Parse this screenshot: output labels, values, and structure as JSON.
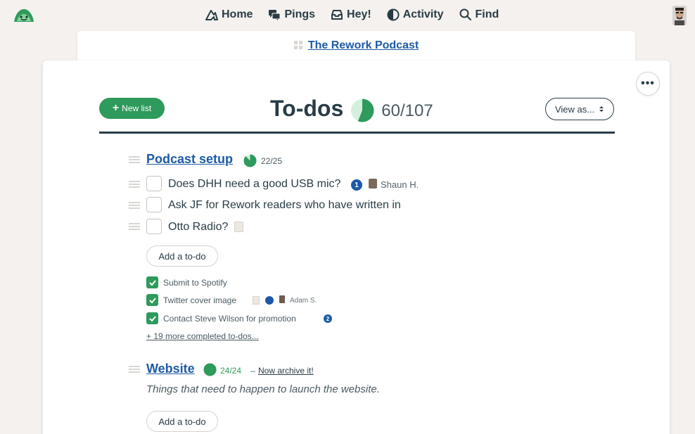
{
  "nav": {
    "items": [
      {
        "label": "Home",
        "icon": "home-icon"
      },
      {
        "label": "Pings",
        "icon": "pings-icon"
      },
      {
        "label": "Hey!",
        "icon": "hey-icon"
      },
      {
        "label": "Activity",
        "icon": "activity-icon"
      },
      {
        "label": "Find",
        "icon": "search-icon"
      }
    ]
  },
  "project": {
    "name": "The Rework Podcast"
  },
  "header": {
    "new_list_label": "New list",
    "title": "To-dos",
    "count": "60/107",
    "progress": 0.56,
    "view_as_label": "View as...",
    "more_label": "•••"
  },
  "lists": [
    {
      "title": "Podcast setup",
      "count": "22/25",
      "progress": 0.88,
      "todos": [
        {
          "text": "Does DHH need a good USB mic?",
          "comments": "1",
          "assignee": "Shaun H."
        },
        {
          "text": "Ask JF for Rework readers who have written in"
        },
        {
          "text": "Otto Radio?",
          "has_note": true
        }
      ],
      "add_label": "Add a to-do",
      "completed": [
        {
          "text": "Submit to Spotify"
        },
        {
          "text": "Twitter cover image",
          "has_note": true,
          "comments": "",
          "assignee": "Adam S."
        },
        {
          "text": "Contact Steve Wilson for promotion",
          "comments": "2"
        }
      ],
      "more_completed": "+ 19 more completed to-dos..."
    },
    {
      "title": "Website",
      "count": "24/24",
      "progress": 1.0,
      "archive_label": "Now archive it!",
      "description": "Things that need to happen to launch the website.",
      "add_label": "Add a to-do"
    }
  ],
  "colors": {
    "brand_green": "#2e9a5b",
    "link_blue": "#1d5aa6",
    "text_dark": "#283c46",
    "background": "#f4f1ee"
  }
}
